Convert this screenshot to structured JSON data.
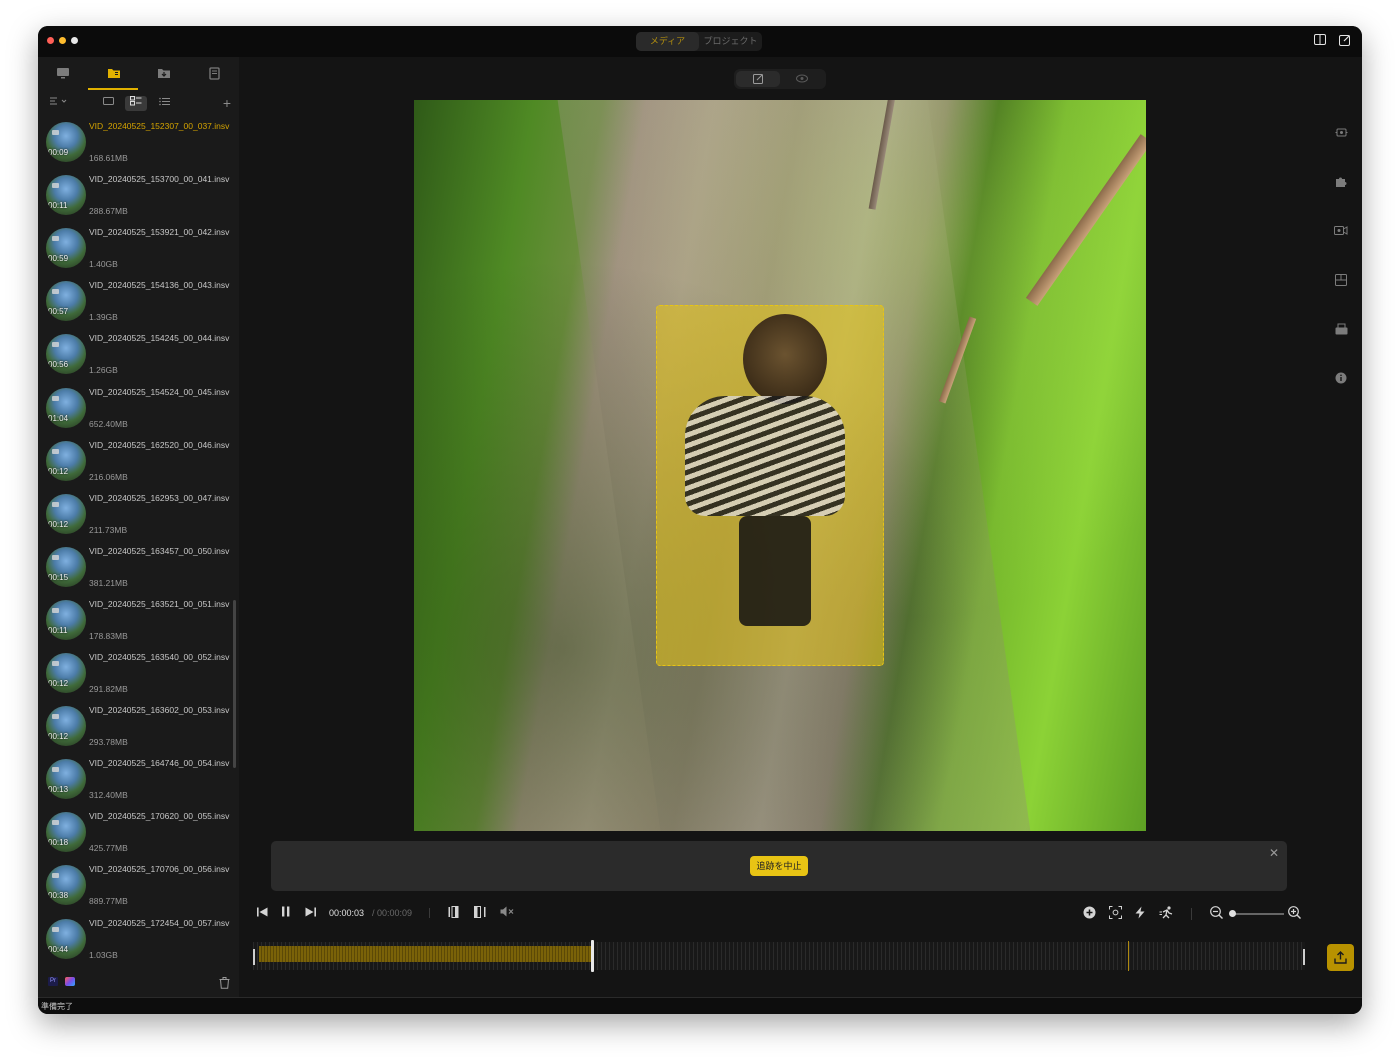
{
  "window": {
    "segments": [
      {
        "label": "メディア",
        "active": true
      },
      {
        "label": "プロジェクト",
        "active": false
      }
    ]
  },
  "sidebar": {
    "tabs": [
      {
        "name": "monitor-icon"
      },
      {
        "name": "media-folder-icon",
        "active": true
      },
      {
        "name": "import-folder-icon"
      },
      {
        "name": "document-icon"
      }
    ],
    "files": [
      {
        "name": "VID_20240525_152307_00_037.insv",
        "duration": "00:09",
        "size": "168.61MB",
        "active": true
      },
      {
        "name": "VID_20240525_153700_00_041.insv",
        "duration": "00:11",
        "size": "288.67MB"
      },
      {
        "name": "VID_20240525_153921_00_042.insv",
        "duration": "00:59",
        "size": "1.40GB"
      },
      {
        "name": "VID_20240525_154136_00_043.insv",
        "duration": "00:57",
        "size": "1.39GB"
      },
      {
        "name": "VID_20240525_154245_00_044.insv",
        "duration": "00:56",
        "size": "1.26GB"
      },
      {
        "name": "VID_20240525_154524_00_045.insv",
        "duration": "01:04",
        "size": "652.40MB"
      },
      {
        "name": "VID_20240525_162520_00_046.insv",
        "duration": "00:12",
        "size": "216.06MB"
      },
      {
        "name": "VID_20240525_162953_00_047.insv",
        "duration": "00:12",
        "size": "211.73MB"
      },
      {
        "name": "VID_20240525_163457_00_050.insv",
        "duration": "00:15",
        "size": "381.21MB"
      },
      {
        "name": "VID_20240525_163521_00_051.insv",
        "duration": "00:11",
        "size": "178.83MB"
      },
      {
        "name": "VID_20240525_163540_00_052.insv",
        "duration": "00:12",
        "size": "291.82MB"
      },
      {
        "name": "VID_20240525_163602_00_053.insv",
        "duration": "00:12",
        "size": "293.78MB"
      },
      {
        "name": "VID_20240525_164746_00_054.insv",
        "duration": "00:13",
        "size": "312.40MB"
      },
      {
        "name": "VID_20240525_170620_00_055.insv",
        "duration": "00:18",
        "size": "425.77MB"
      },
      {
        "name": "VID_20240525_170706_00_056.insv",
        "duration": "00:38",
        "size": "889.77MB"
      },
      {
        "name": "VID_20240525_172454_00_057.insv",
        "duration": "00:44",
        "size": "1.03GB"
      }
    ]
  },
  "status": {
    "text": "準備完了"
  },
  "tracking": {
    "stop_label": "追跡を中止"
  },
  "player": {
    "current_time": "00:00:03",
    "total_time": "/ 00:00:09",
    "progress": 0.32
  },
  "colors": {
    "accent": "#e1b100",
    "tracking_box": "#e8c414",
    "background": "#141414"
  }
}
